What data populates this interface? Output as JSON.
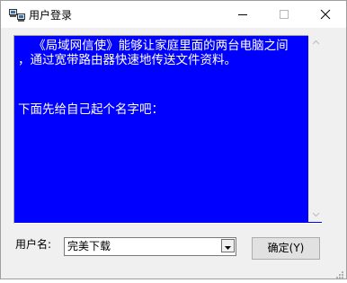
{
  "window": {
    "title": "用户登录",
    "icon": "computer-icon",
    "controls": {
      "minimize": "minimize-icon",
      "maximize": "maximize-icon",
      "close": "close-icon"
    }
  },
  "message": {
    "lines": [
      "    《局域网信使》能够让家庭里面的两台电脑之间",
      "，通过宽带路由器快速地传送文件资料。",
      "",
      "",
      "",
      "下面先给自己起个名字吧："
    ],
    "background_color": "#0000ff",
    "text_color": "#ffffff"
  },
  "form": {
    "username_label": "用户名:",
    "username_value": "完美下载",
    "ok_label": "确定(Y)"
  }
}
